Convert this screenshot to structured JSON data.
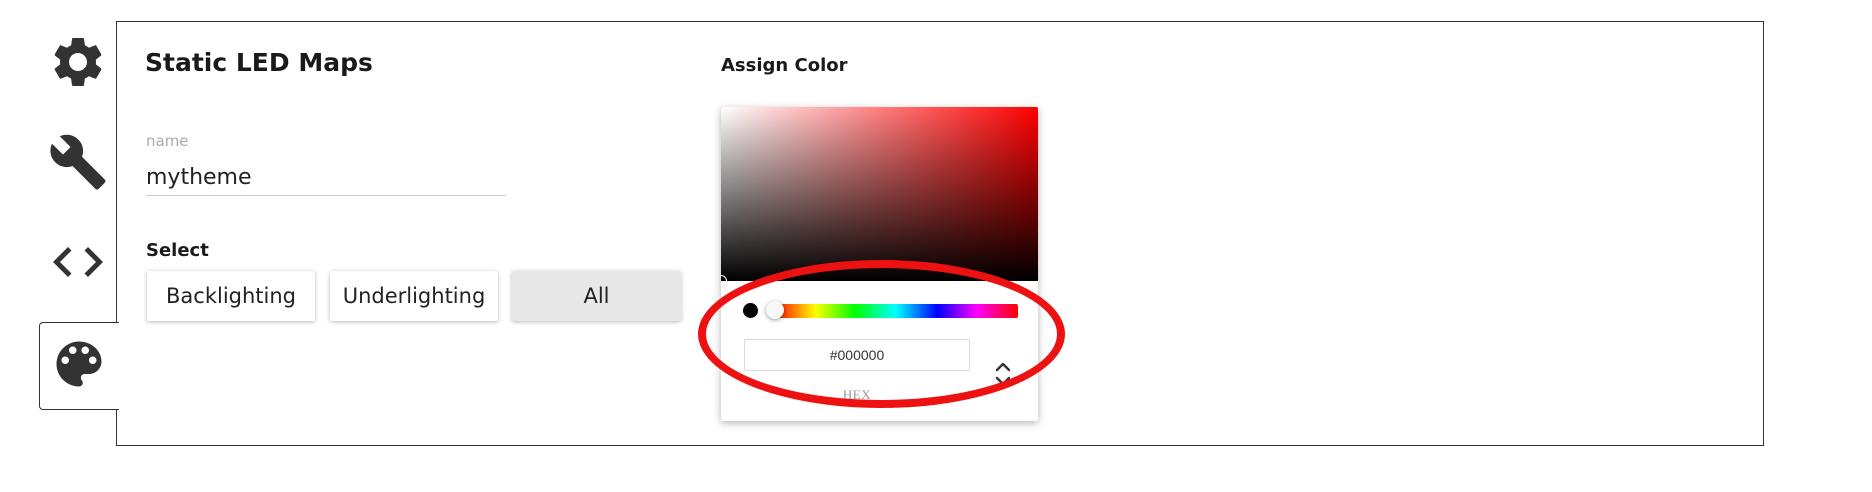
{
  "sidebar": {
    "items": [
      {
        "name": "settings",
        "icon": "gear-icon"
      },
      {
        "name": "tools",
        "icon": "wrench-icon"
      },
      {
        "name": "code",
        "icon": "code-icon"
      },
      {
        "name": "theme",
        "icon": "palette-icon",
        "active": true
      }
    ]
  },
  "page": {
    "title": "Static LED Maps",
    "name_label": "name",
    "name_value": "mytheme",
    "select_label": "Select",
    "buttons": [
      "Backlighting",
      "Underlighting",
      "All"
    ],
    "active_button": "All"
  },
  "color": {
    "assign_label": "Assign Color",
    "hex_value": "#000000",
    "mode_label": "HEX",
    "current_color": "#000000",
    "hue_color": "#ff0000"
  },
  "annotation": {
    "color": "#ee1111",
    "shape": "ellipse"
  }
}
